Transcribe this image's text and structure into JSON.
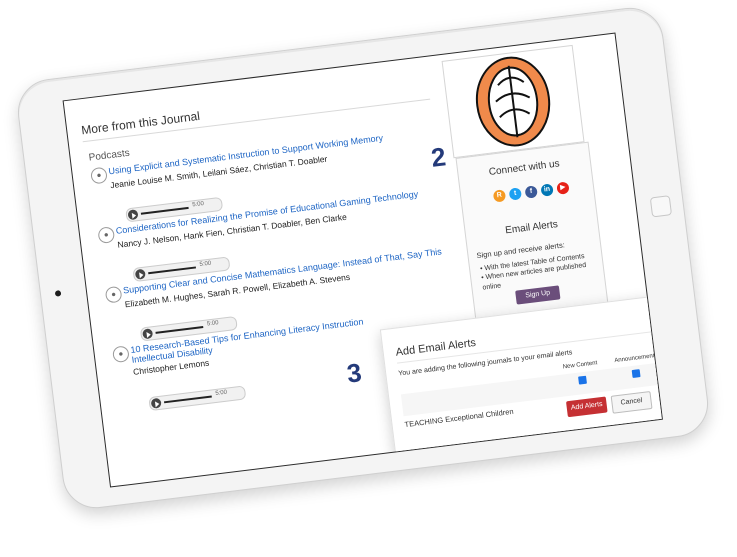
{
  "page": {
    "section_title": "More from this Journal",
    "podcasts_heading": "Podcasts"
  },
  "podcasts": [
    {
      "title": "Using Explicit and Systematic Instruction to Support Working Memory",
      "authors": "Jeanie Louise M. Smith, Leilani Sáez, Christian T. Doabler",
      "time": "5:00"
    },
    {
      "title": "Considerations for Realizing the Promise of Educational Gaming Technology",
      "authors": "Nancy J. Nelson, Hank Fien, Christian T. Doabler, Ben Clarke",
      "time": "5:00"
    },
    {
      "title": "Supporting Clear and Concise Mathematics Language: Instead of That, Say This",
      "authors": "Elizabeth M. Hughes, Sarah R. Powell, Elizabeth A. Stevens",
      "time": "5:00"
    },
    {
      "title": "10 Research-Based Tips for Enhancing Literacy Instruction",
      "title_line2": "Intellectual Disability",
      "authors": "Christopher Lemons",
      "time": "5:00"
    }
  ],
  "sidebar": {
    "connect_title": "Connect with us",
    "social_icons": [
      {
        "name": "rss-icon",
        "color": "#f59a23",
        "glyph": "R"
      },
      {
        "name": "twitter-icon",
        "color": "#1da1f2",
        "glyph": "t"
      },
      {
        "name": "facebook-icon",
        "color": "#3b5998",
        "glyph": "f"
      },
      {
        "name": "linkedin-icon",
        "color": "#0077b5",
        "glyph": "in"
      },
      {
        "name": "youtube-icon",
        "color": "#e62117",
        "glyph": "▶"
      }
    ],
    "alerts_title": "Email Alerts",
    "alerts_desc": "Sign up and receive alerts:",
    "alerts_items": [
      "With the latest Table of Contents",
      "When new articles are published online"
    ],
    "signup_label": "Sign Up"
  },
  "modal": {
    "close": "×",
    "title": "Add Email Alerts",
    "desc": "You are adding the following journals to your email alerts",
    "col_new": "New Content",
    "col_ann": "Announcements",
    "journal": "TEACHING Exceptional Children",
    "add_label": "Add Alerts",
    "cancel_label": "Cancel"
  },
  "labels": {
    "two": "2",
    "three": "3"
  },
  "colors": {
    "link": "#1c64c4",
    "signup": "#6b4e7b",
    "add_alerts": "#c53033",
    "label_number": "#243a7a"
  }
}
